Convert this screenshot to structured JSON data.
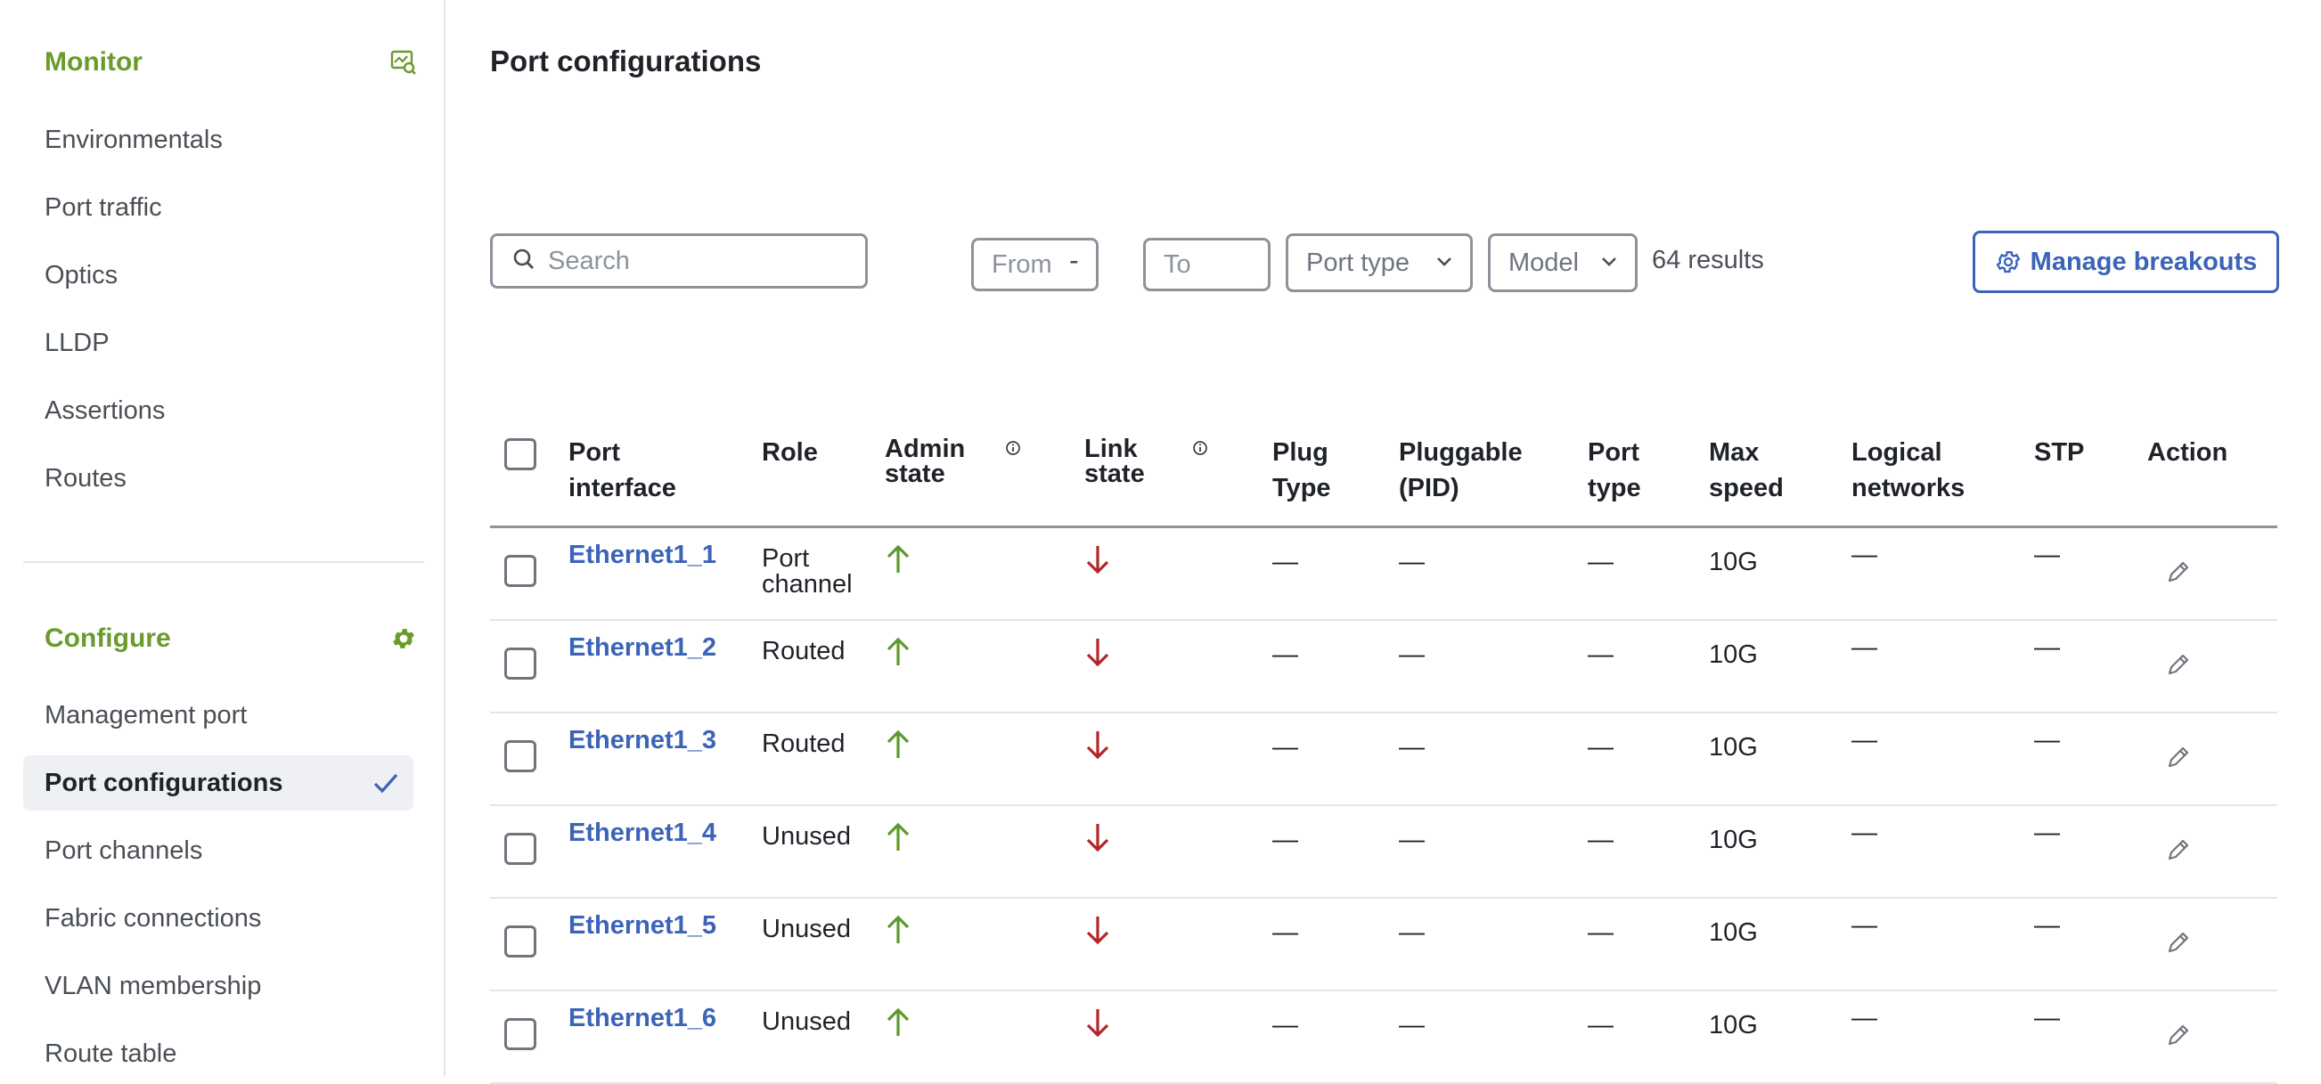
{
  "sidebar": {
    "monitor": {
      "title": "Monitor",
      "icon": "monitor-search-icon",
      "items": [
        {
          "label": "Environmentals"
        },
        {
          "label": "Port traffic"
        },
        {
          "label": "Optics"
        },
        {
          "label": "LLDP"
        },
        {
          "label": "Assertions"
        },
        {
          "label": "Routes"
        }
      ]
    },
    "configure": {
      "title": "Configure",
      "icon": "gear-icon",
      "items": [
        {
          "label": "Management port",
          "active": false
        },
        {
          "label": "Port configurations",
          "active": true
        },
        {
          "label": "Port channels",
          "active": false
        },
        {
          "label": "Fabric connections",
          "active": false
        },
        {
          "label": "VLAN membership",
          "active": false
        },
        {
          "label": "Route table",
          "active": false
        }
      ]
    }
  },
  "main": {
    "title": "Port configurations",
    "toolbar": {
      "search_placeholder": "Search",
      "from_placeholder": "From",
      "range_separator": "-",
      "to_placeholder": "To",
      "port_type_label": "Port type",
      "model_label": "Model",
      "results": "64 results",
      "manage_breakouts_label": "Manage breakouts"
    },
    "table": {
      "headers": {
        "port_interface": "Port interface",
        "role": "Role",
        "admin_state": "Admin state",
        "link_state": "Link state",
        "plug_type": "Plug Type",
        "pluggable": "Pluggable (PID)",
        "port_type": "Port type",
        "max_speed": "Max speed",
        "logical_networks": "Logical networks",
        "stp": "STP",
        "action": "Action"
      },
      "rows": [
        {
          "port": "Ethernet1_1",
          "role": "Port channel",
          "admin": "up",
          "link": "down",
          "plug_type": "—",
          "pluggable": "—",
          "port_type": "—",
          "max_speed": "10G",
          "logical_networks": "—",
          "stp": "—"
        },
        {
          "port": "Ethernet1_2",
          "role": "Routed",
          "admin": "up",
          "link": "down",
          "plug_type": "—",
          "pluggable": "—",
          "port_type": "—",
          "max_speed": "10G",
          "logical_networks": "—",
          "stp": "—"
        },
        {
          "port": "Ethernet1_3",
          "role": "Routed",
          "admin": "up",
          "link": "down",
          "plug_type": "—",
          "pluggable": "—",
          "port_type": "—",
          "max_speed": "10G",
          "logical_networks": "—",
          "stp": "—"
        },
        {
          "port": "Ethernet1_4",
          "role": "Unused",
          "admin": "up",
          "link": "down",
          "plug_type": "—",
          "pluggable": "—",
          "port_type": "—",
          "max_speed": "10G",
          "logical_networks": "—",
          "stp": "—"
        },
        {
          "port": "Ethernet1_5",
          "role": "Unused",
          "admin": "up",
          "link": "down",
          "plug_type": "—",
          "pluggable": "—",
          "port_type": "—",
          "max_speed": "10G",
          "logical_networks": "—",
          "stp": "—"
        },
        {
          "port": "Ethernet1_6",
          "role": "Unused",
          "admin": "up",
          "link": "down",
          "plug_type": "—",
          "pluggable": "—",
          "port_type": "—",
          "max_speed": "10G",
          "logical_networks": "—",
          "stp": "—"
        }
      ]
    }
  },
  "colors": {
    "accent_green": "#6a9b2c",
    "link_blue": "#3b63b8",
    "state_up": "#5a9a2a",
    "state_down": "#b3252a"
  }
}
